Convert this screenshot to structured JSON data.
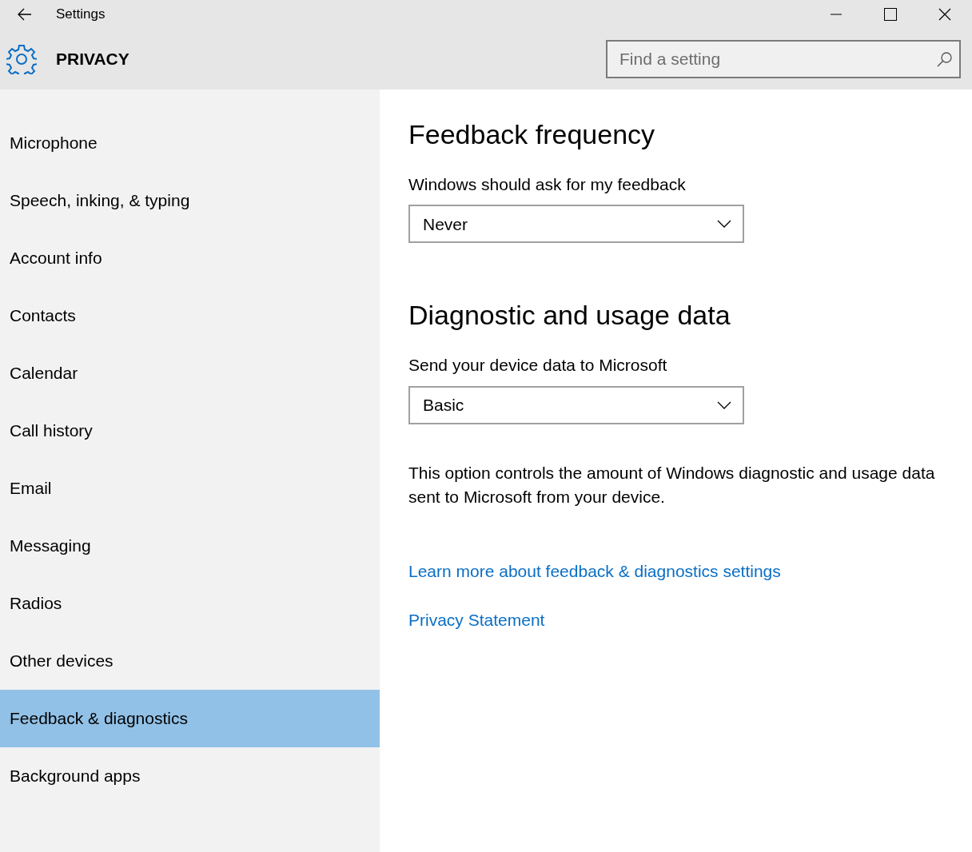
{
  "window": {
    "title": "Settings"
  },
  "header": {
    "title": "PRIVACY",
    "search": {
      "placeholder": "Find a setting"
    }
  },
  "sidebar": {
    "items": [
      {
        "label": "Microphone",
        "selected": false
      },
      {
        "label": "Speech, inking, & typing",
        "selected": false
      },
      {
        "label": "Account info",
        "selected": false
      },
      {
        "label": "Contacts",
        "selected": false
      },
      {
        "label": "Calendar",
        "selected": false
      },
      {
        "label": "Call history",
        "selected": false
      },
      {
        "label": "Email",
        "selected": false
      },
      {
        "label": "Messaging",
        "selected": false
      },
      {
        "label": "Radios",
        "selected": false
      },
      {
        "label": "Other devices",
        "selected": false
      },
      {
        "label": "Feedback & diagnostics",
        "selected": true
      },
      {
        "label": "Background apps",
        "selected": false
      }
    ]
  },
  "sections": [
    {
      "heading": "Feedback frequency",
      "label": "Windows should ask for my feedback",
      "dropdown": {
        "value": "Never"
      }
    },
    {
      "heading": "Diagnostic and usage data",
      "label": "Send your device data to Microsoft",
      "dropdown": {
        "value": "Basic"
      },
      "description": "This option controls the amount of Windows diagnostic and usage data sent to Microsoft from your device."
    }
  ],
  "links": [
    "Learn more about feedback & diagnostics settings",
    "Privacy Statement"
  ]
}
